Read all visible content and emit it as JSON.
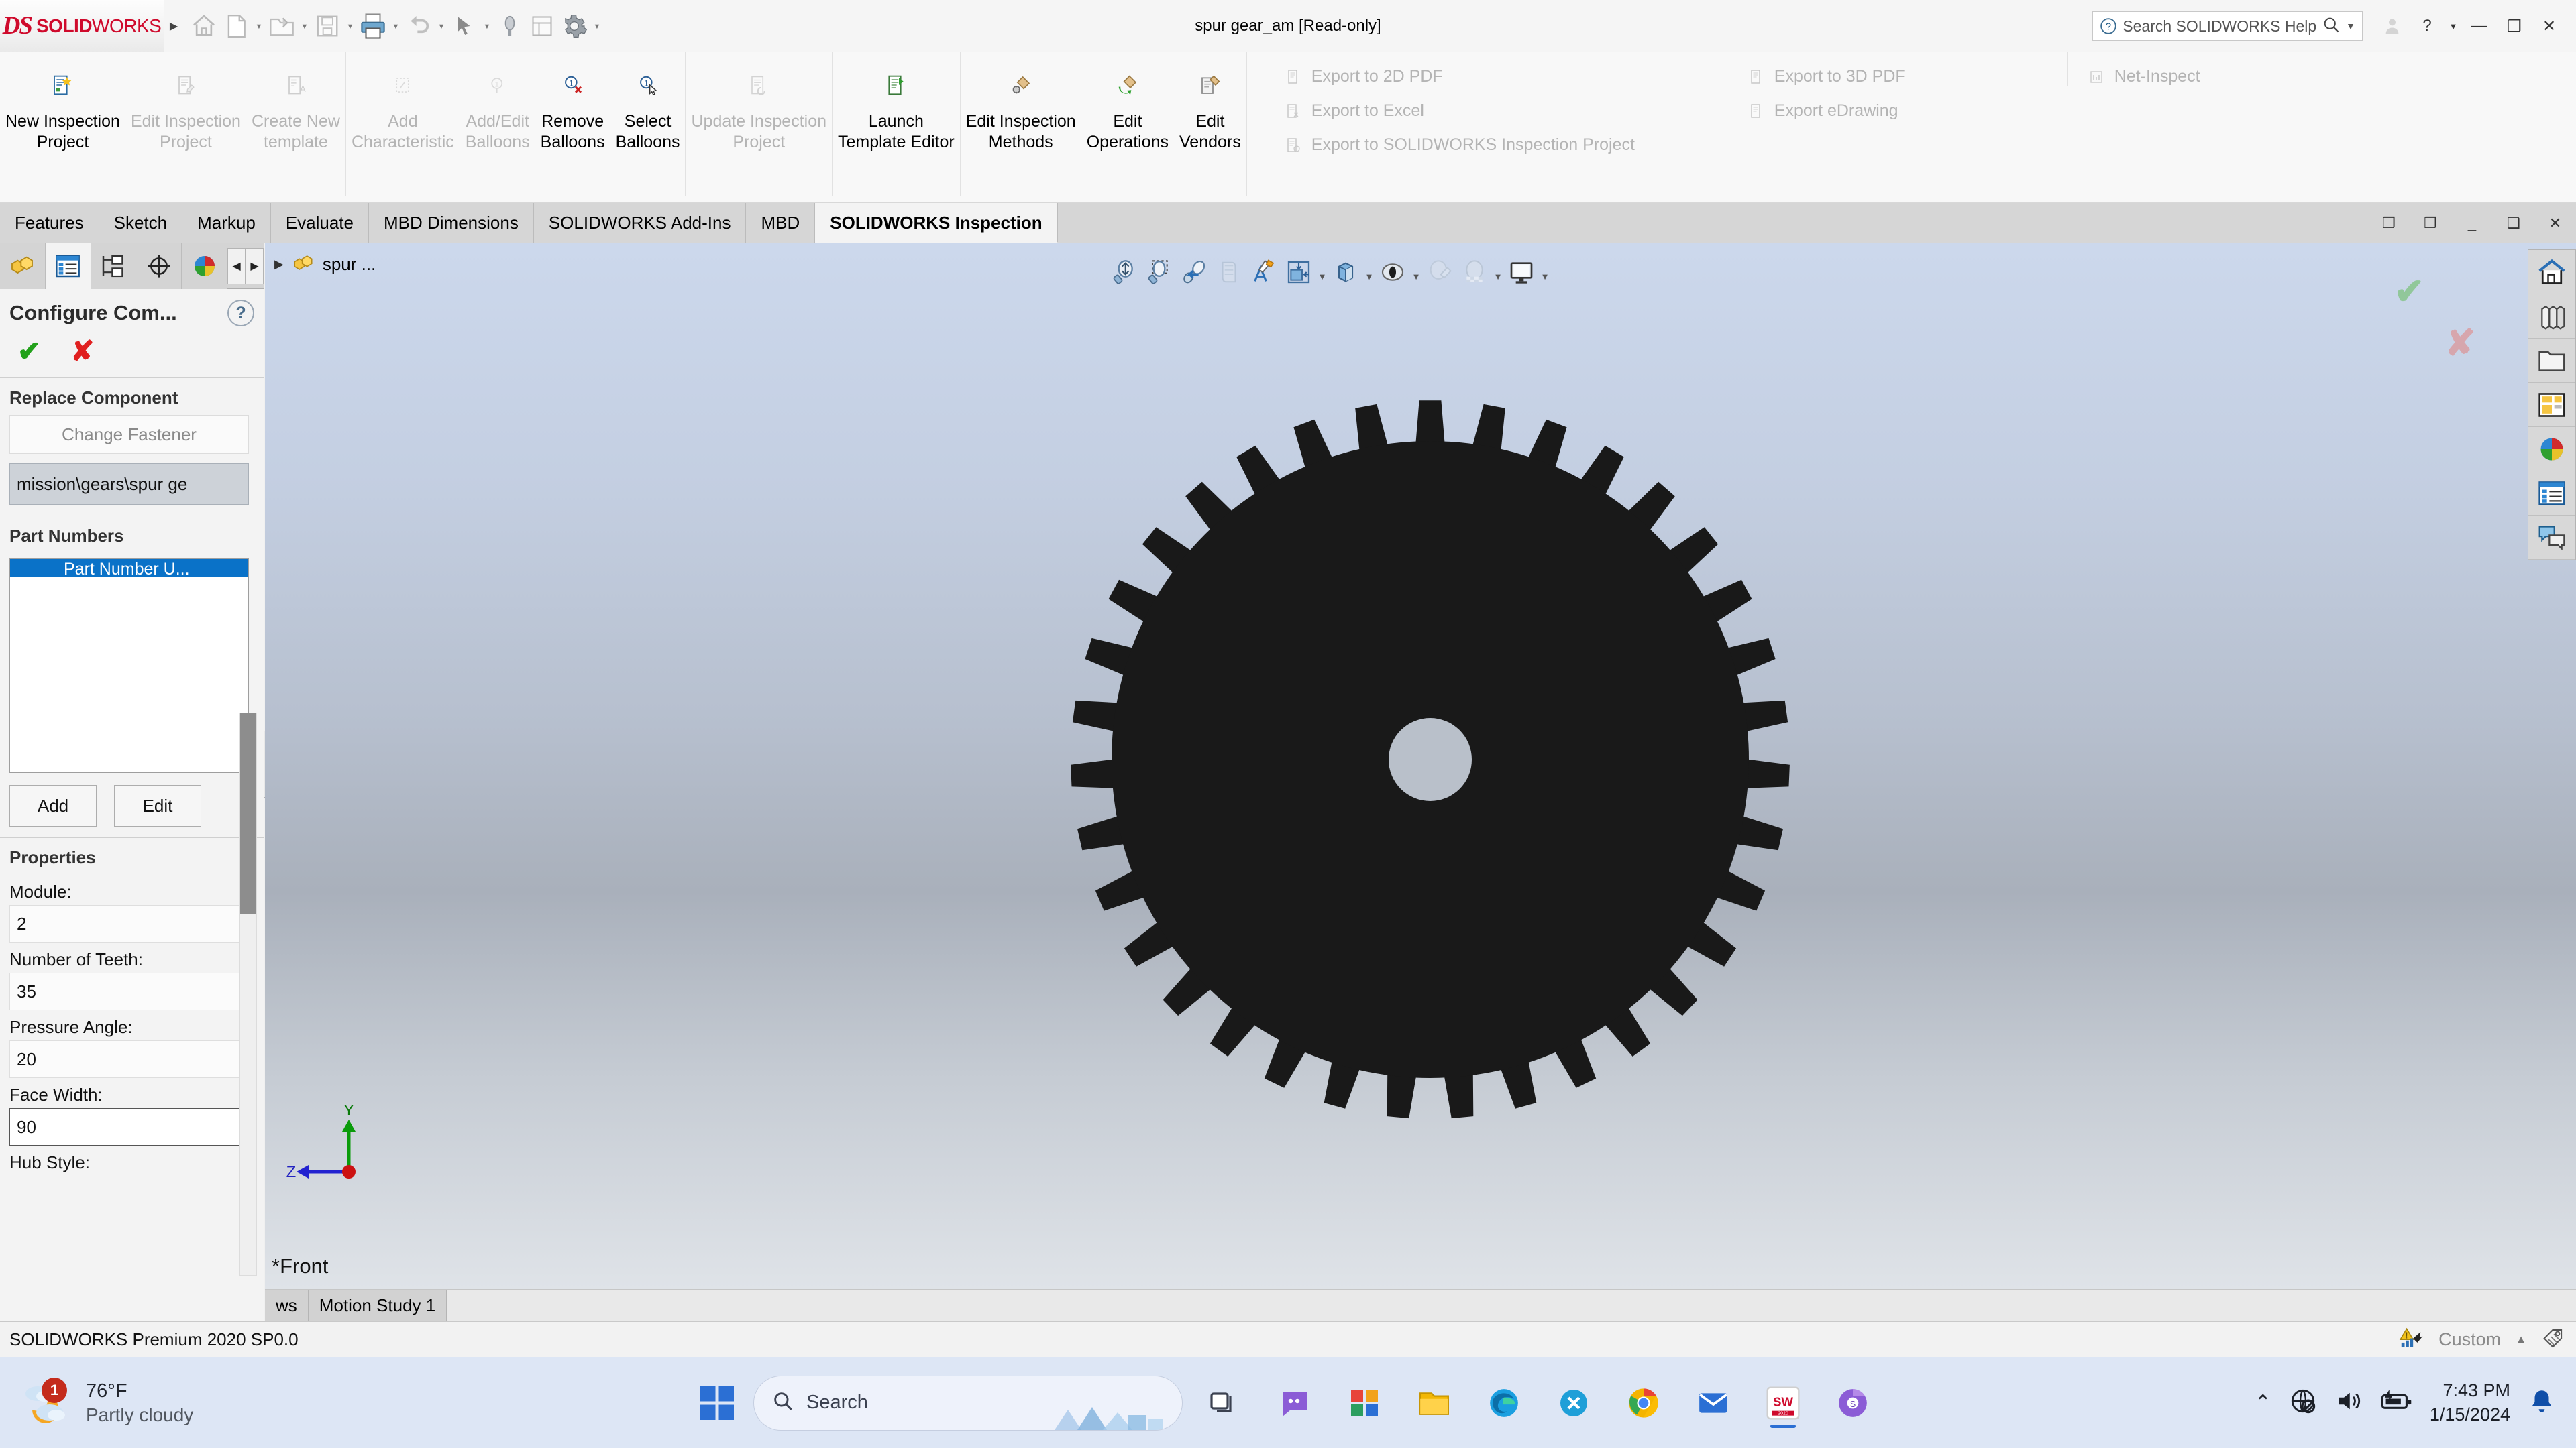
{
  "titlebar": {
    "logo_mark": "DS",
    "logo_solid": "SOLID",
    "logo_works": "WORKS",
    "document_title": "spur gear_am [Read-only]",
    "help_search_placeholder": "Search SOLIDWORKS Help",
    "quick_access": [
      {
        "name": "home-icon",
        "label": "Home"
      },
      {
        "name": "new-document-icon",
        "label": "New"
      },
      {
        "name": "open-folder-icon",
        "label": "Open"
      },
      {
        "name": "save-icon",
        "label": "Save"
      },
      {
        "name": "print-icon",
        "label": "Print"
      },
      {
        "name": "undo-icon",
        "label": "Undo"
      },
      {
        "name": "select-arrow-icon",
        "label": "Select"
      },
      {
        "name": "magnify-icon",
        "label": "Zoom"
      },
      {
        "name": "rebuild-icon",
        "label": "Rebuild"
      },
      {
        "name": "options-gear-icon",
        "label": "Options"
      }
    ],
    "window_controls": {
      "account": "account-icon",
      "help": "?",
      "minimize": "—",
      "restore": "❐",
      "close": "✕"
    }
  },
  "ribbon": {
    "groups": [
      {
        "buttons": [
          {
            "label": "New Inspection\nProject",
            "enabled": true,
            "icon": "new-inspection-project-icon"
          },
          {
            "label": "Edit Inspection\nProject",
            "enabled": false,
            "icon": "edit-inspection-project-icon"
          },
          {
            "label": "Create New\ntemplate",
            "enabled": false,
            "icon": "create-new-template-icon"
          }
        ]
      },
      {
        "buttons": [
          {
            "label": "Add\nCharacteristic",
            "enabled": false,
            "icon": "add-characteristic-icon"
          }
        ]
      },
      {
        "buttons": [
          {
            "label": "Add/Edit\nBalloons",
            "enabled": false,
            "icon": "add-edit-balloons-icon"
          },
          {
            "label": "Remove\nBalloons",
            "enabled": true,
            "icon": "remove-balloons-icon"
          },
          {
            "label": "Select\nBalloons",
            "enabled": true,
            "icon": "select-balloons-icon"
          }
        ]
      },
      {
        "buttons": [
          {
            "label": "Update Inspection\nProject",
            "enabled": false,
            "icon": "update-inspection-project-icon"
          }
        ]
      },
      {
        "buttons": [
          {
            "label": "Launch\nTemplate Editor",
            "enabled": true,
            "icon": "launch-template-editor-icon"
          }
        ]
      },
      {
        "buttons": [
          {
            "label": "Edit Inspection\nMethods",
            "enabled": true,
            "icon": "edit-inspection-methods-icon"
          },
          {
            "label": "Edit\nOperations",
            "enabled": true,
            "icon": "edit-operations-icon"
          },
          {
            "label": "Edit\nVendors",
            "enabled": true,
            "icon": "edit-vendors-icon"
          }
        ]
      }
    ],
    "export_column_1": [
      {
        "label": "Export to 2D PDF",
        "enabled": false,
        "icon": "export-2d-pdf-icon"
      },
      {
        "label": "Export to Excel",
        "enabled": false,
        "icon": "export-excel-icon"
      },
      {
        "label": "Export to SOLIDWORKS Inspection Project",
        "enabled": false,
        "icon": "export-inspection-project-icon"
      }
    ],
    "export_column_2": [
      {
        "label": "Export to 3D PDF",
        "enabled": false,
        "icon": "export-3d-pdf-icon"
      },
      {
        "label": "Export eDrawing",
        "enabled": false,
        "icon": "export-edrawing-icon"
      }
    ],
    "export_column_3": [
      {
        "label": "Net-Inspect",
        "enabled": false,
        "icon": "net-inspect-icon"
      }
    ]
  },
  "tabs": {
    "items": [
      {
        "label": "Features",
        "active": false
      },
      {
        "label": "Sketch",
        "active": false
      },
      {
        "label": "Markup",
        "active": false
      },
      {
        "label": "Evaluate",
        "active": false
      },
      {
        "label": "MBD Dimensions",
        "active": false
      },
      {
        "label": "SOLIDWORKS Add-Ins",
        "active": false
      },
      {
        "label": "MBD",
        "active": false
      },
      {
        "label": "SOLIDWORKS Inspection",
        "active": true
      }
    ]
  },
  "property_manager": {
    "tabs": [
      {
        "name": "feature-manager-tab",
        "active": false
      },
      {
        "name": "property-manager-tab",
        "active": true
      },
      {
        "name": "configuration-manager-tab",
        "active": false
      },
      {
        "name": "dimxpert-manager-tab",
        "active": false
      },
      {
        "name": "display-manager-tab",
        "active": false
      }
    ],
    "title": "Configure Com...",
    "ok_label": "✔",
    "cancel_label": "✘",
    "help_label": "?",
    "replace_component": {
      "header": "Replace Component",
      "change_fastener_label": "Change Fastener",
      "path_value": "mission\\gears\\spur ge"
    },
    "part_numbers": {
      "header": "Part Numbers",
      "column_header": "Part Number U...",
      "add_label": "Add",
      "edit_label": "Edit"
    },
    "properties": {
      "header": "Properties",
      "fields": [
        {
          "label": "Module:",
          "value": "2",
          "focused": false
        },
        {
          "label": "Number of Teeth:",
          "value": "35",
          "focused": false
        },
        {
          "label": "Pressure Angle:",
          "value": "20",
          "focused": false
        },
        {
          "label": "Face Width:",
          "value": "90",
          "focused": true
        },
        {
          "label": "Hub Style:",
          "value": "",
          "focused": false
        }
      ]
    }
  },
  "viewport": {
    "feature_tree_root": "spur ...",
    "view_orientation_label": "*Front",
    "toolbar": [
      {
        "name": "zoom-to-fit-icon",
        "caret": false
      },
      {
        "name": "zoom-to-area-icon",
        "caret": false
      },
      {
        "name": "previous-view-icon",
        "caret": false
      },
      {
        "name": "section-view-icon",
        "caret": false
      },
      {
        "name": "view-orientation-icon",
        "caret": false
      },
      {
        "name": "display-style-icon",
        "caret": true
      },
      {
        "name": "isometric-box-icon",
        "caret": true
      },
      {
        "name": "hide-show-items-icon",
        "caret": true
      },
      {
        "name": "edit-appearance-icon",
        "caret": false
      },
      {
        "name": "apply-scene-icon",
        "caret": true
      },
      {
        "name": "view-settings-icon",
        "caret": true
      }
    ],
    "triad": {
      "y_label": "Y",
      "z_label": "Z"
    },
    "confirm_corner": {
      "accept": "✔",
      "reject": "✘"
    }
  },
  "task_pane": [
    {
      "name": "solidworks-resources-icon"
    },
    {
      "name": "design-library-icon"
    },
    {
      "name": "file-explorer-icon"
    },
    {
      "name": "view-palette-icon"
    },
    {
      "name": "appearances-scenes-icon"
    },
    {
      "name": "custom-properties-icon"
    },
    {
      "name": "solidworks-forum-icon"
    }
  ],
  "bottom_tabs": {
    "items": [
      {
        "label": "ws",
        "active": false
      },
      {
        "label": "Motion Study 1",
        "active": true
      }
    ]
  },
  "statusbar": {
    "left_text": "SOLIDWORKS Premium 2020 SP0.0",
    "custom_label": "Custom",
    "warning_icon": "performance-warning-icon",
    "tag_icon": "tag-icon"
  },
  "taskbar": {
    "weather": {
      "temperature": "76°F",
      "condition": "Partly cloudy",
      "badge": "1",
      "icon": "partly-cloudy-night-icon"
    },
    "start_label": "start-icon",
    "search_placeholder": "Search",
    "apps": [
      {
        "name": "task-view-icon"
      },
      {
        "name": "chat-teams-icon"
      },
      {
        "name": "widgets-icon"
      },
      {
        "name": "file-explorer-taskbar-icon"
      },
      {
        "name": "microsoft-edge-icon"
      },
      {
        "name": "vscode-icon"
      },
      {
        "name": "google-chrome-icon"
      },
      {
        "name": "mail-icon"
      },
      {
        "name": "solidworks-taskbar-icon",
        "active": true
      },
      {
        "name": "chrome-beta-icon"
      }
    ],
    "tray": {
      "overflow": "⌃",
      "network": "network-disconnected-icon",
      "volume": "volume-icon",
      "battery": "battery-charging-icon",
      "time": "7:43 PM",
      "date": "1/15/2024",
      "notification": "notification-bell-icon"
    }
  }
}
